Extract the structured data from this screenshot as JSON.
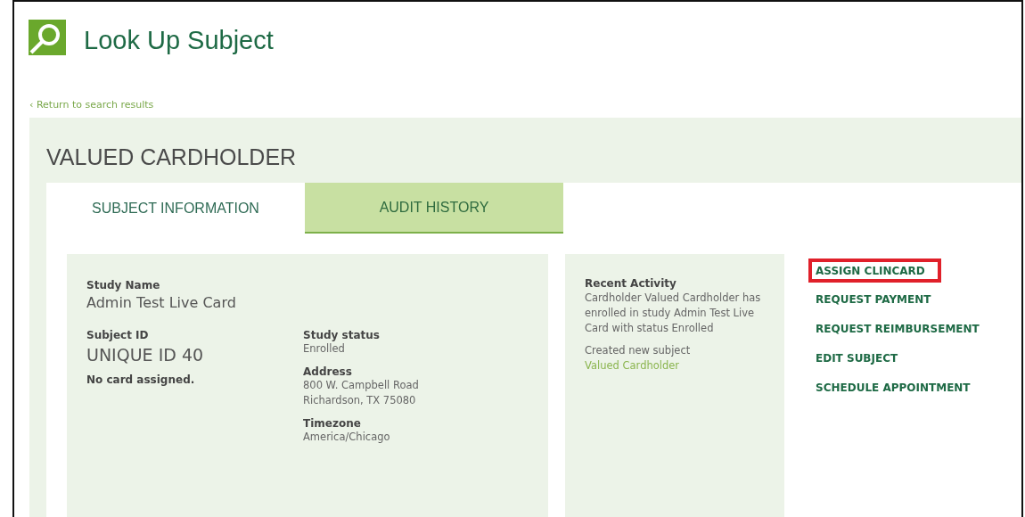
{
  "header": {
    "title": "Look Up Subject"
  },
  "back_link": "Return to search results",
  "back_caret": "‹",
  "subject_name": "VALUED CARDHOLDER",
  "tabs": [
    {
      "label": "SUBJECT INFORMATION",
      "selected": true
    },
    {
      "label": "AUDIT HISTORY",
      "selected": false
    }
  ],
  "study_name": {
    "label": "Study Name",
    "value": "Admin Test Live Card"
  },
  "subject_id": {
    "label": "Subject ID",
    "value": "UNIQUE ID 40"
  },
  "card_note": "No card assigned.",
  "details": [
    {
      "label": "Study status",
      "lines": [
        "Enrolled"
      ]
    },
    {
      "label": "Address",
      "lines": [
        "800 W. Campbell Road",
        "Richardson, TX 75080"
      ]
    },
    {
      "label": "Timezone",
      "lines": [
        "America/Chicago"
      ]
    }
  ],
  "recent_activity": {
    "title": "Recent Activity",
    "entries": [
      {
        "text": "Cardholder Valued Cardholder has enrolled in study Admin Test Live Card with status Enrolled"
      },
      {
        "text": "Created new subject",
        "link": "Valued Cardholder"
      }
    ]
  },
  "actions": [
    {
      "label": "ASSIGN CLINCARD",
      "highlighted": true
    },
    {
      "label": "REQUEST PAYMENT",
      "highlighted": false
    },
    {
      "label": "REQUEST REIMBURSEMENT",
      "highlighted": false
    },
    {
      "label": "EDIT SUBJECT",
      "highlighted": false
    },
    {
      "label": "SCHEDULE APPOINTMENT",
      "highlighted": false
    }
  ]
}
